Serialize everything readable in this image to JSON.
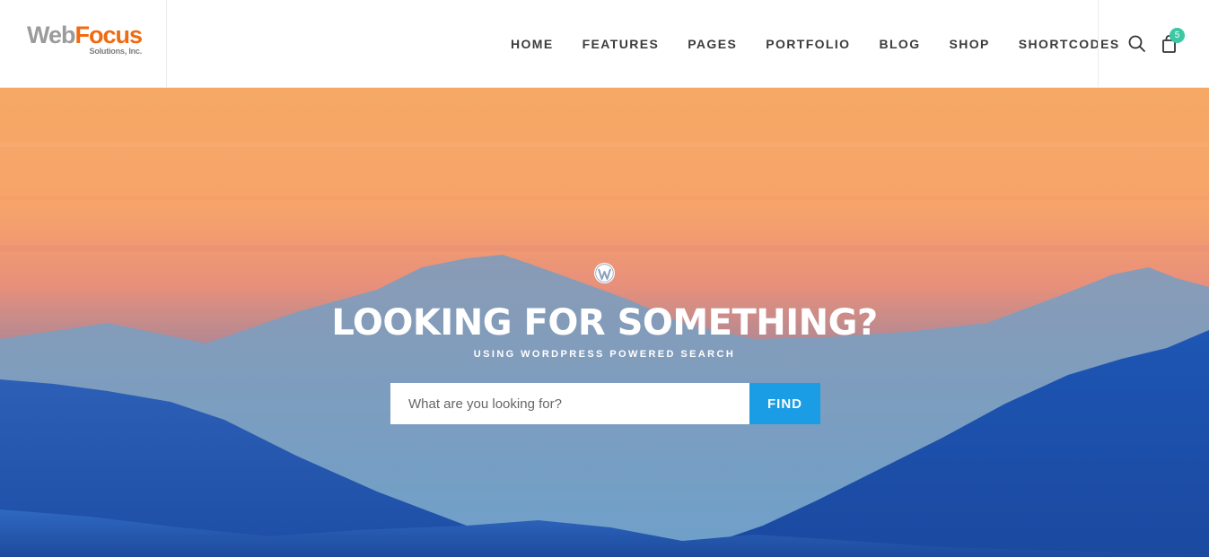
{
  "logo": {
    "word1": "Web",
    "word2": "Focus",
    "tagline": "Solutions, Inc."
  },
  "nav": {
    "items": [
      {
        "label": "HOME"
      },
      {
        "label": "FEATURES"
      },
      {
        "label": "PAGES"
      },
      {
        "label": "PORTFOLIO"
      },
      {
        "label": "BLOG"
      },
      {
        "label": "SHOP"
      },
      {
        "label": "SHORTCODES"
      }
    ]
  },
  "tools": {
    "search_icon": "search-icon",
    "cart_icon": "shopping-bag-icon",
    "cart_count": "5"
  },
  "hero": {
    "icon": "wordpress-icon",
    "title": "LOOKING FOR SOMETHING?",
    "subtitle": "USING WORDPRESS POWERED SEARCH",
    "search": {
      "placeholder": "What are you looking for?",
      "value": "",
      "button_label": "FIND"
    }
  },
  "colors": {
    "logo_gray": "#9b9b9b",
    "logo_orange": "#f06a12",
    "badge": "#3cc8a4",
    "find_button": "#1a9de4",
    "sky_top": "#f6a865",
    "mountain_dark": "#1f4fb0"
  }
}
